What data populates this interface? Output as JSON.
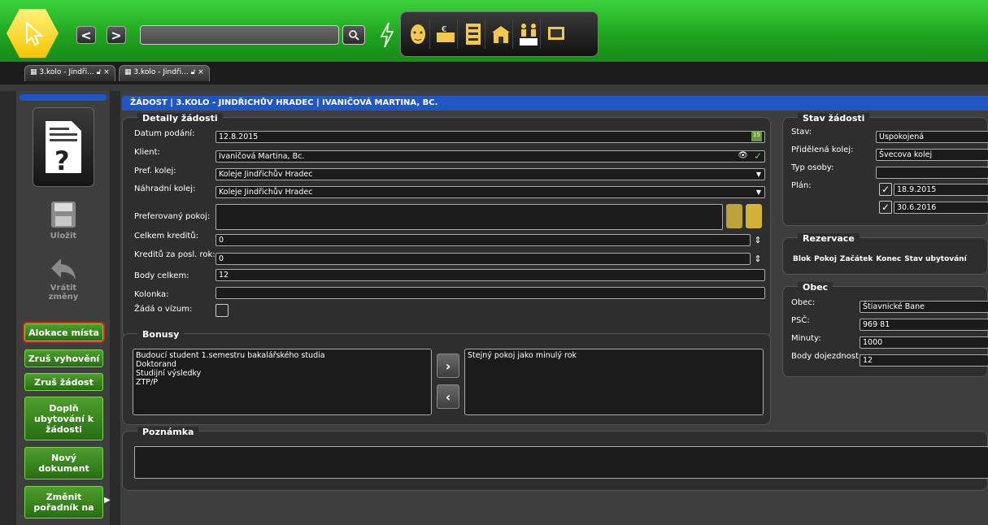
{
  "tabs": [
    {
      "label": "3.kolo - Jindři..."
    },
    {
      "label": "3.kolo - Jindři..."
    }
  ],
  "tab_close": "×",
  "nav": {
    "back": "<",
    "forward": ">"
  },
  "search": {
    "placeholder": ""
  },
  "modules": [
    "face-icon",
    "money-icon",
    "list-icon",
    "building-icon",
    "persons-ab-icon",
    "screen-icon"
  ],
  "sidebar": {
    "save_label": "Uložit",
    "revert_label_1": "Vrátit",
    "revert_label_2": "změny",
    "buttons": {
      "alloc": "Alokace místa",
      "cancel_eval": "Zruš vyhovění",
      "cancel_request": "Zruš žádost",
      "add_accomm_1": "Doplň",
      "add_accomm_2": "ubytování k",
      "add_accomm_3": "žádosti",
      "new_doc_1": "Nový",
      "new_doc_2": "dokument",
      "change_order_1": "Změnit",
      "change_order_2": "pořadník na"
    }
  },
  "main": {
    "title": "ŽÁDOST | 3.KOLO - JINDŘICHŮV HRADEC | IVANIČOVÁ MARTINA, BC.",
    "details": {
      "title": "Detaily žádosti",
      "labels": {
        "datum": "Datum podání:",
        "klient": "Klient:",
        "pref_kolej": "Pref. kolej:",
        "nahr_kolej": "Náhradní kolej:",
        "pref_pokoj": "Preferovaný pokoj:",
        "kredity": "Celkem kreditů:",
        "kredity_rok": "Kreditů za posl. rok:",
        "body": "Body celkem:",
        "kolonka": "Kolonka:",
        "vizum": "Žádá o vízum:"
      },
      "values": {
        "datum": "12.8.2015",
        "klient": "Ivaničová Martina, Bc.",
        "pref_kolej": "Koleje Jindřichův Hradec",
        "nahr_kolej": "Koleje Jindřichův Hradec",
        "pref_pokoj": "",
        "kredity": "0",
        "kredity_rok": "0",
        "body": "12",
        "kolonka": ""
      }
    },
    "bonusy": {
      "title": "Bonusy",
      "available": [
        "Budoucí student 1.semestru bakalářského studia",
        "Doktorand",
        "Studijní výsledky",
        "ZTP/P"
      ],
      "selected": [
        "Stejný pokoj jako minulý rok"
      ]
    },
    "poznamka": {
      "title": "Poznámka",
      "value": ""
    },
    "stav": {
      "title": "Stav žádosti",
      "labels": {
        "stav": "Stav:",
        "kolej": "Přidělená kolej:",
        "typ": "Typ osoby:",
        "plan": "Plán:"
      },
      "values": {
        "stav": "Uspokojená",
        "kolej": "Švecova kolej",
        "typ": "",
        "plan_from": "18.9.2015",
        "plan_to": "30.6.2016"
      }
    },
    "rezervace": {
      "title": "Rezervace",
      "columns": [
        "Blok",
        "Pokoj",
        "Začátek",
        "Konec",
        "Stav ubytování"
      ]
    },
    "obec": {
      "title": "Obec",
      "labels": {
        "obec": "Obec:",
        "psc": "PSČ:",
        "minuty": "Minuty:",
        "body": "Body dojezdnost:"
      },
      "values": {
        "obec": "Štiavnické Bane",
        "psc": "969 81",
        "minuty": "1000",
        "body": "12"
      }
    }
  },
  "colors": {
    "accent_green": "#2fbf2f",
    "title_blue": "#2057c2",
    "alert_red": "#e02020"
  }
}
